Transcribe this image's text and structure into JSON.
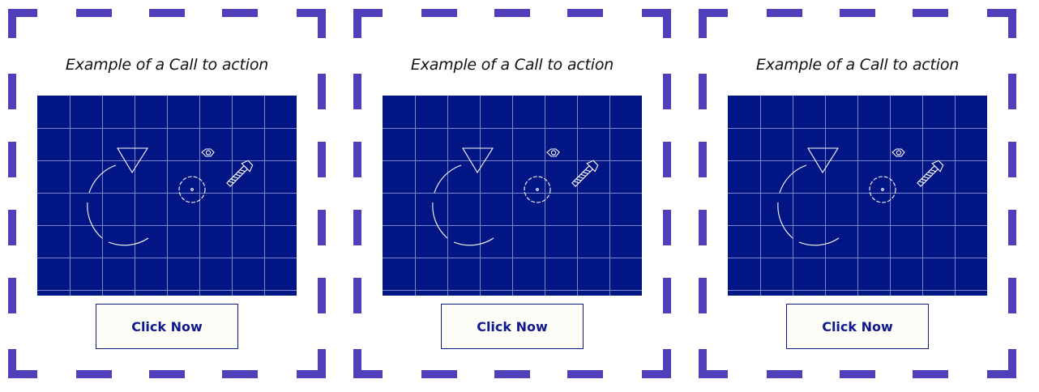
{
  "colors": {
    "frame": "#4f3fba",
    "blueprint": "#021584",
    "grid": "#7d86c4",
    "lines": "#ffffff",
    "button_text": "#0e1a8a",
    "button_bg": "#fdfdf8"
  },
  "cards": [
    {
      "title": "Example of a Call to action",
      "image_icon": "blueprint-drawing-icon",
      "button_label": "Click Now"
    },
    {
      "title": "Example of a Call to action",
      "image_icon": "blueprint-drawing-icon",
      "button_label": "Click Now"
    },
    {
      "title": "Example of a Call to action",
      "image_icon": "blueprint-drawing-icon",
      "button_label": "Click Now"
    }
  ]
}
